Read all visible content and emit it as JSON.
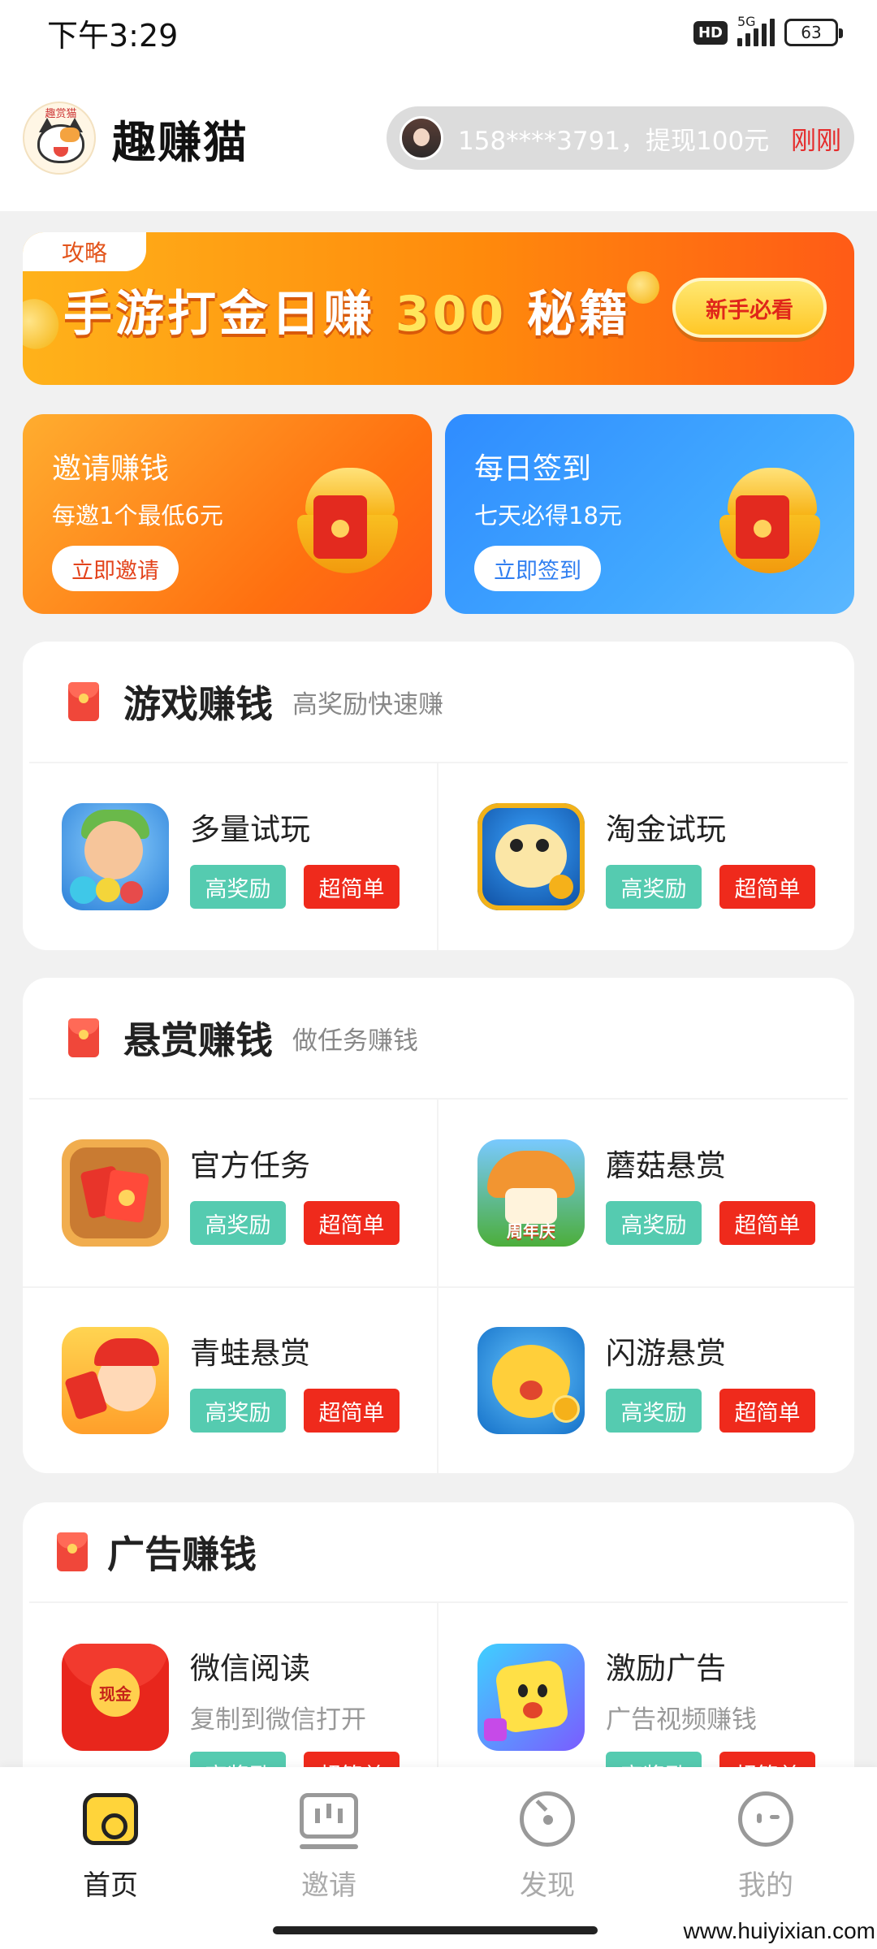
{
  "status_bar": {
    "time": "下午3:29",
    "hd": "HD",
    "network": "5G",
    "battery": "63"
  },
  "header": {
    "logo_text": "趣赏猫",
    "app_title": "趣赚猫",
    "ticker_text": "158****3791，提现100元",
    "ticker_time": "刚刚"
  },
  "banner": {
    "tag": "攻略",
    "title_part1": "手游打金日赚",
    "title_highlight": "300",
    "title_part2": "秘籍",
    "button": "新手必看"
  },
  "promos": {
    "invite": {
      "title": "邀请赚钱",
      "subtitle": "每邀1个最低6元",
      "button": "立即邀请"
    },
    "sign": {
      "title": "每日签到",
      "subtitle": "七天必得18元",
      "button": "立即签到"
    }
  },
  "sections": {
    "game": {
      "title": "游戏赚钱",
      "subtitle": "高奖励快速赚",
      "items": [
        {
          "title": "多量试玩",
          "tag1": "高奖励",
          "tag2": "超简单",
          "icon": "bubble-game-icon"
        },
        {
          "title": "淘金试玩",
          "tag1": "高奖励",
          "tag2": "超简单",
          "icon": "puffer-fish-game-icon"
        }
      ]
    },
    "bounty": {
      "title": "悬赏赚钱",
      "subtitle": "做任务赚钱",
      "items": [
        {
          "title": "官方任务",
          "tag1": "高奖励",
          "tag2": "超简单",
          "icon": "red-envelope-task-icon"
        },
        {
          "title": "蘑菇悬赏",
          "tag1": "高奖励",
          "tag2": "超简单",
          "icon": "mushroom-anniversary-icon",
          "icon_label": "周年庆"
        },
        {
          "title": "青蛙悬赏",
          "tag1": "高奖励",
          "tag2": "超简单",
          "icon": "frog-character-icon"
        },
        {
          "title": "闪游悬赏",
          "tag1": "高奖励",
          "tag2": "超简单",
          "icon": "puffer-coin-icon"
        }
      ]
    },
    "ads": {
      "title": "广告赚钱",
      "items": [
        {
          "title": "微信阅读",
          "desc": "复制到微信打开",
          "tag1": "高奖励",
          "tag2": "超简单",
          "icon": "cash-envelope-icon",
          "icon_label": "现金"
        },
        {
          "title": "激励广告",
          "desc": "广告视频赚钱",
          "tag1": "高奖励",
          "tag2": "超简单",
          "icon": "yellow-cube-character-icon"
        }
      ]
    }
  },
  "bottom_nav": [
    {
      "label": "首页",
      "icon": "home-icon",
      "active": true
    },
    {
      "label": "邀请",
      "icon": "invite-board-icon",
      "active": false
    },
    {
      "label": "发现",
      "icon": "compass-icon",
      "active": false
    },
    {
      "label": "我的",
      "icon": "face-icon",
      "active": false
    }
  ],
  "watermark": "www.huiyixian.com",
  "colors": {
    "accent_orange": "#ff7010",
    "accent_blue": "#2f8cff",
    "tag_green": "#55cbb0",
    "tag_red": "#ef2a1c",
    "ticker_time_red": "#e52c2c"
  }
}
